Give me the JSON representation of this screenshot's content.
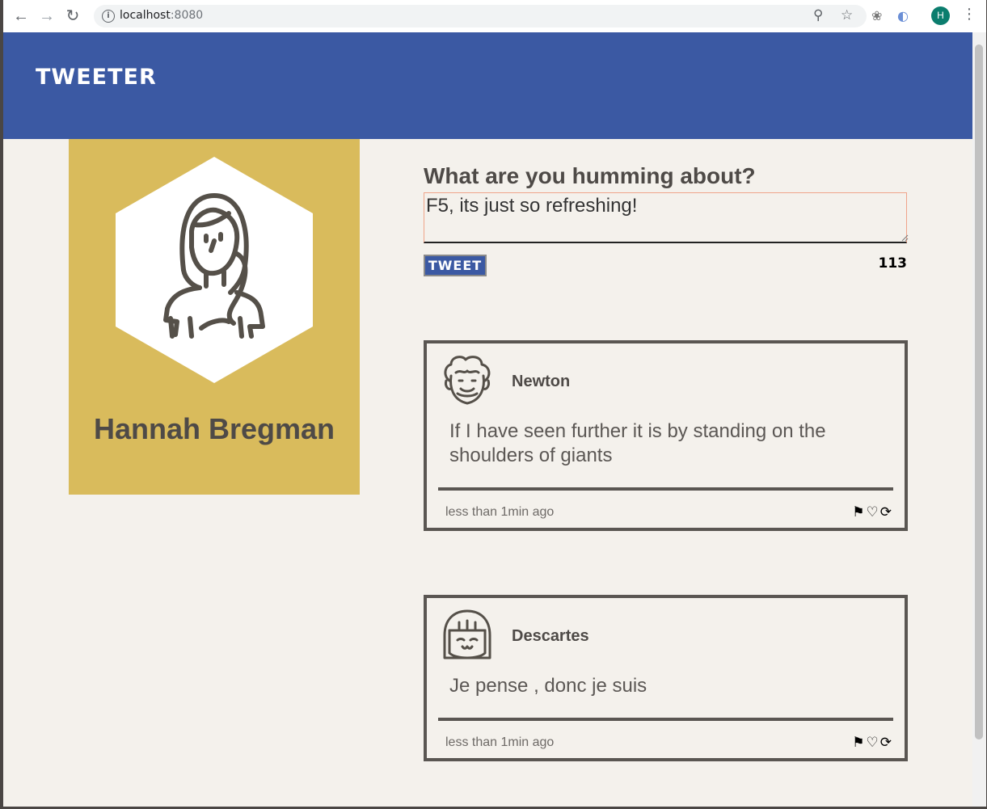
{
  "browser": {
    "url_host": "localhost",
    "url_port": ":8080",
    "profile_initial": "H",
    "icons": [
      "back-icon",
      "forward-icon",
      "reload-icon",
      "info-icon",
      "zoom-icon",
      "star-icon",
      "bug-icon",
      "extension-icon",
      "menu-icon"
    ]
  },
  "nav": {
    "brand": "TWEETER",
    "color": "#3b59a3"
  },
  "profile": {
    "name": "Hannah Bregman",
    "card_color": "#d9bb5c"
  },
  "compose": {
    "title": "What are you humming about?",
    "value": "F5, its just so refreshing!",
    "button_label": "TWEET",
    "counter": "113"
  },
  "tweets": [
    {
      "handle": "Newton",
      "text": "If I have seen further it is by standing on the shoulders of giants",
      "time": "less than 1min ago",
      "actions": [
        "flag-icon",
        "heart-icon",
        "retweet-icon"
      ]
    },
    {
      "handle": "Descartes",
      "text": "Je pense , donc je suis",
      "time": "less than 1min ago",
      "actions": [
        "flag-icon",
        "heart-icon",
        "retweet-icon"
      ]
    }
  ]
}
